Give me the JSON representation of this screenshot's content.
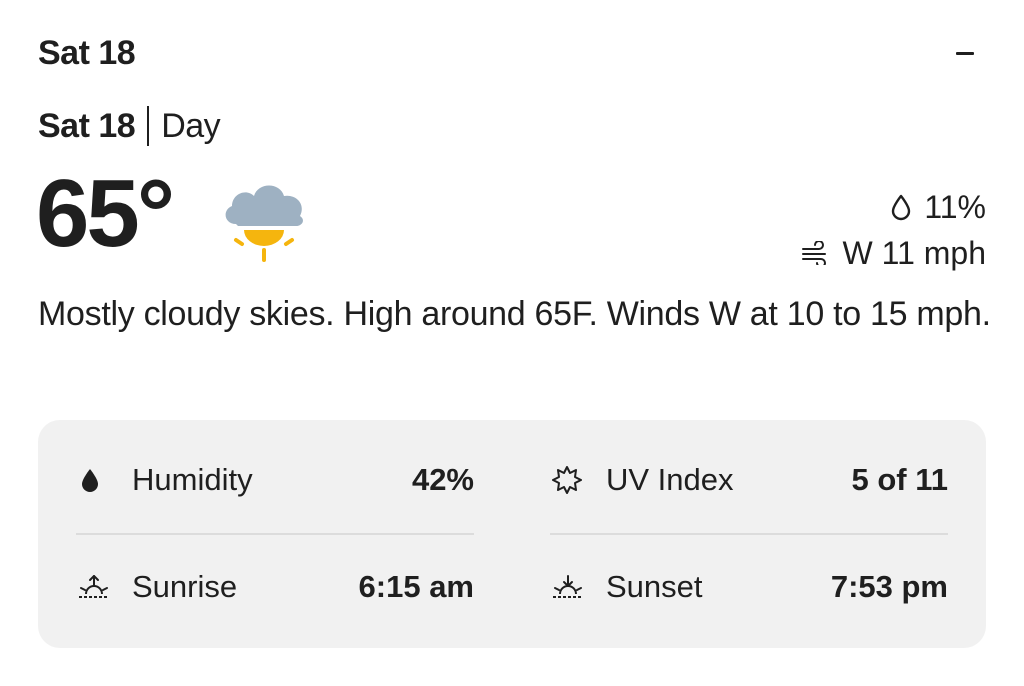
{
  "header": {
    "title": "Sat 18",
    "collapse_icon": "minus-icon"
  },
  "subheader": {
    "date": "Sat 18",
    "period": "Day"
  },
  "current": {
    "temperature": "65°",
    "condition_icon": "partly-cloudy-sun-icon",
    "precip_icon": "raindrop-outline-icon",
    "precip": "11%",
    "wind_icon": "wind-icon",
    "wind": "W 11 mph"
  },
  "description": "Mostly cloudy skies. High around 65F. Winds W at 10 to 15 mph.",
  "details": {
    "humidity": {
      "icon": "drop-filled-icon",
      "label": "Humidity",
      "value": "42%"
    },
    "uv": {
      "icon": "uv-sun-icon",
      "label": "UV Index",
      "value": "5 of 11"
    },
    "sunrise": {
      "icon": "sunrise-icon",
      "label": "Sunrise",
      "value": "6:15 am"
    },
    "sunset": {
      "icon": "sunset-icon",
      "label": "Sunset",
      "value": "7:53 pm"
    }
  },
  "colors": {
    "text": "#1f1f1f",
    "card_bg": "#f1f1f1",
    "cloud": "#9eb1c2",
    "sun": "#f5b50e"
  }
}
